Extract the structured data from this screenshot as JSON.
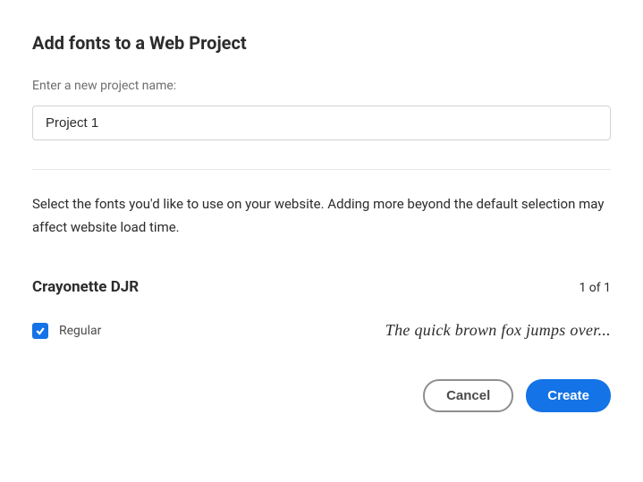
{
  "header": {
    "title": "Add fonts to a Web Project"
  },
  "project": {
    "label": "Enter a new project name:",
    "value": "Project 1"
  },
  "description": "Select the fonts you'd like to use on your website. Adding more beyond the default selection may affect website load time.",
  "font": {
    "name": "Crayonette DJR",
    "count": "1 of 1",
    "variant": {
      "checked": true,
      "label": "Regular",
      "sample": "The quick brown fox jumps over..."
    }
  },
  "actions": {
    "cancel": "Cancel",
    "create": "Create"
  }
}
